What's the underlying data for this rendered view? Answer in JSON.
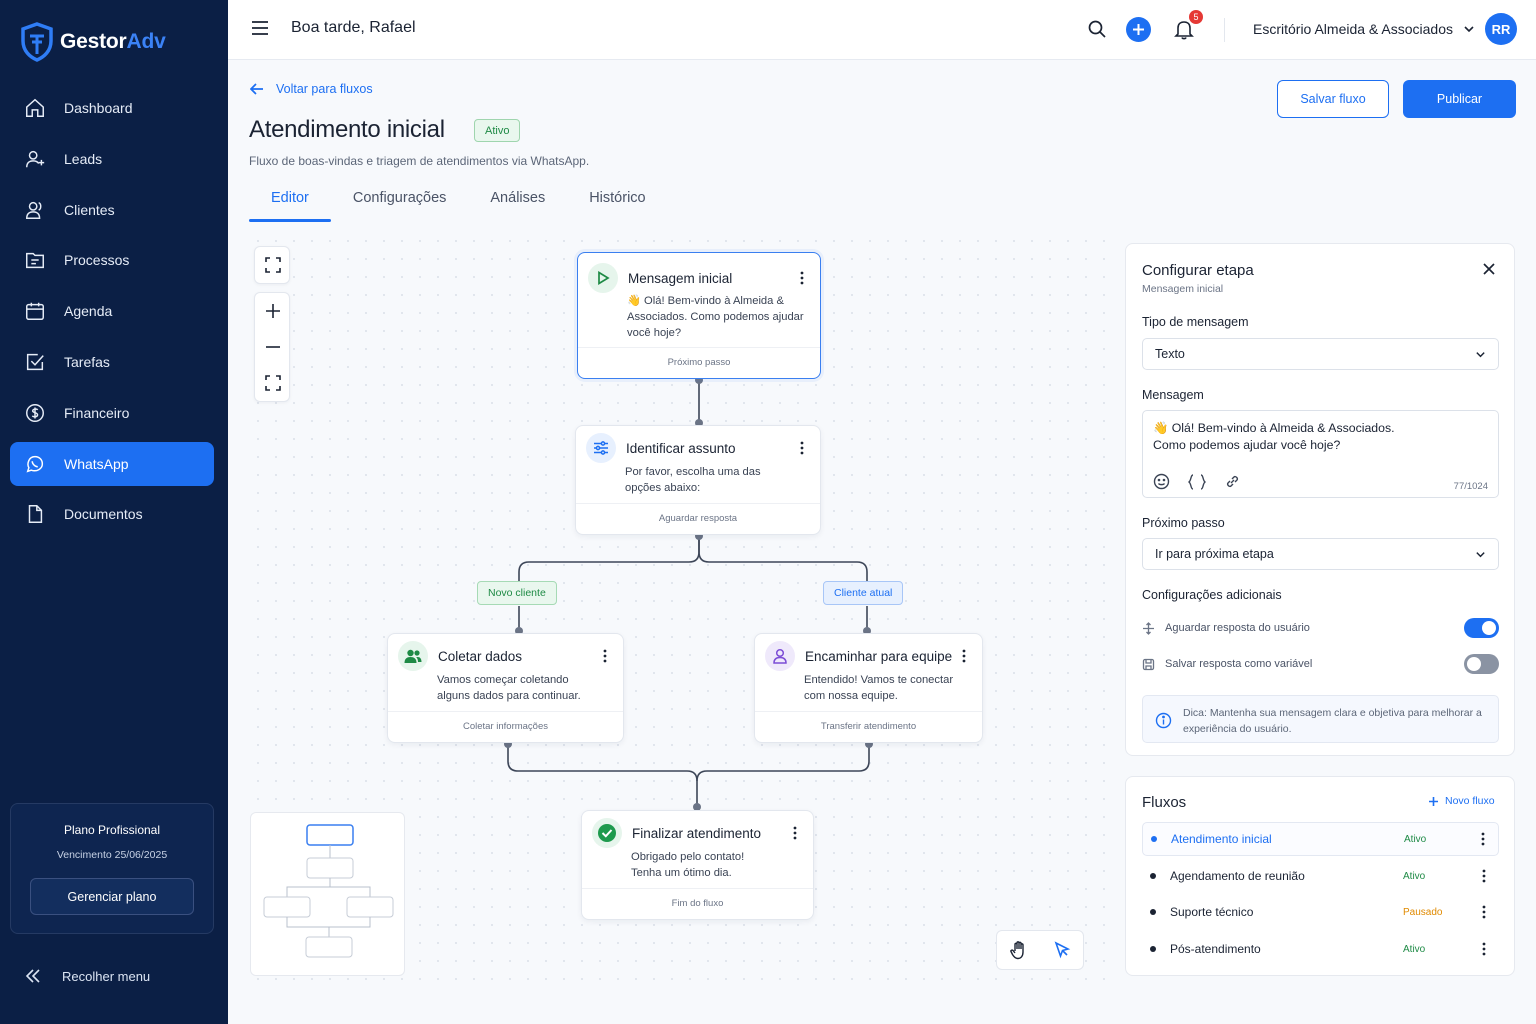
{
  "app": {
    "logo_main": "Gestor",
    "logo_accent": "Adv",
    "brand_color": "#1d6ff2",
    "sidebar_color": "#0b1f45"
  },
  "sidebar": {
    "items": [
      {
        "label": "Dashboard",
        "icon": "home-icon"
      },
      {
        "label": "Leads",
        "icon": "user-plus-icon"
      },
      {
        "label": "Clientes",
        "icon": "users-icon"
      },
      {
        "label": "Processos",
        "icon": "folder-icon"
      },
      {
        "label": "Agenda",
        "icon": "calendar-icon"
      },
      {
        "label": "Tarefas",
        "icon": "checkbox-icon"
      },
      {
        "label": "Financeiro",
        "icon": "dollar-icon"
      },
      {
        "label": "WhatsApp",
        "icon": "whatsapp-icon",
        "active": true
      },
      {
        "label": "Documentos",
        "icon": "document-icon"
      }
    ],
    "plan": {
      "name": "Plano Profissional",
      "expiry": "Vencimento 25/06/2025",
      "manage_label": "Gerenciar plano"
    },
    "collapse_label": "Recolher menu"
  },
  "topbar": {
    "greeting": "Boa tarde, Rafael",
    "notification_count": "5",
    "office_name": "Escritório Almeida & Associados",
    "avatar_initials": "RR"
  },
  "header": {
    "back_label": "Voltar para fluxos",
    "title": "Atendimento inicial",
    "status": "Ativo",
    "description": "Fluxo de boas-vindas e triagem de atendimentos via WhatsApp.",
    "save_label": "Salvar fluxo",
    "publish_label": "Publicar",
    "tabs": [
      "Editor",
      "Configurações",
      "Análises",
      "Histórico"
    ],
    "active_tab": "Editor"
  },
  "flow": {
    "nodes": [
      {
        "title": "Mensagem inicial",
        "body": "👋 Olá! Bem-vindo à Almeida & Associados. Como podemos ajudar você hoje?",
        "footer": "Próximo passo",
        "icon": "play-icon"
      },
      {
        "title": "Identificar assunto",
        "body": "Por favor, escolha uma das opções abaixo:",
        "footer": "Aguardar resposta",
        "icon": "sliders-icon"
      },
      {
        "title": "Coletar dados",
        "body": "Vamos começar coletando alguns dados para continuar.",
        "footer": "Coletar informações",
        "icon": "users-icon"
      },
      {
        "title": "Encaminhar para equipe",
        "body": "Entendido! Vamos te conectar com nossa equipe.",
        "footer": "Transferir atendimento",
        "icon": "user-icon"
      },
      {
        "title": "Finalizar atendimento",
        "body": "Obrigado pelo contato! Tenha um ótimo dia.",
        "footer": "Fim do fluxo",
        "icon": "check-circle-icon"
      }
    ],
    "branches": [
      "Novo cliente",
      "Cliente atual"
    ]
  },
  "config_panel": {
    "title": "Configurar etapa",
    "subtitle": "Mensagem inicial",
    "message_type_label": "Tipo de mensagem",
    "message_type_value": "Texto",
    "message_label": "Mensagem",
    "message_value": "👋 Olá! Bem-vindo à Almeida & Associados.\nComo podemos ajudar você hoje?",
    "char_count": "77/1024",
    "next_step_label": "Próximo passo",
    "next_step_value": "Ir para próxima etapa",
    "extra_label": "Configurações adicionais",
    "options": [
      {
        "label": "Aguardar resposta do usuário",
        "enabled": true
      },
      {
        "label": "Salvar resposta como variável",
        "enabled": false
      }
    ],
    "tip": "Dica: Mantenha sua mensagem clara e objetiva para melhorar a experiência do usuário."
  },
  "flows_panel": {
    "title": "Fluxos",
    "new_label": "Novo fluxo",
    "items": [
      {
        "name": "Atendimento inicial",
        "status": "Ativo",
        "status_color": "#1e8a45",
        "active": true
      },
      {
        "name": "Agendamento de reunião",
        "status": "Ativo",
        "status_color": "#1e8a45"
      },
      {
        "name": "Suporte técnico",
        "status": "Pausado",
        "status_color": "#e08a00"
      },
      {
        "name": "Pós-atendimento",
        "status": "Ativo",
        "status_color": "#1e8a45"
      }
    ]
  }
}
